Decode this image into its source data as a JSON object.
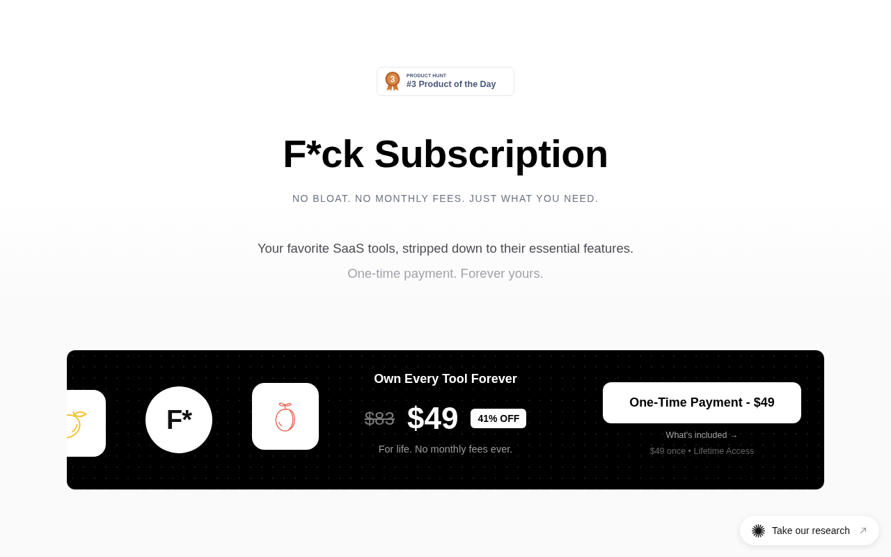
{
  "badge": {
    "rank": "3",
    "eyebrow": "PRODUCT HUNT",
    "title": "#3 Product of the Day"
  },
  "hero": {
    "title": "F*ck Subscription",
    "tagline": "NO BLOAT. NO MONTHLY FEES. JUST WHAT YOU NEED.",
    "description": "Your favorite SaaS tools, stripped down to their essential features.",
    "subdescription": "One-time payment. Forever yours."
  },
  "offer": {
    "apps": [
      {
        "kind": "lemon",
        "color": "#f2c12e"
      },
      {
        "kind": "logo",
        "text": "F*"
      },
      {
        "kind": "peach",
        "color": "#ec6a58"
      }
    ],
    "heading": "Own Every Tool Forever",
    "old_price": "$83",
    "price": "$49",
    "discount": "41% OFF",
    "note": "For life. No monthly fees ever.",
    "button": "One-Time Payment - $49",
    "included_link": "What's included →",
    "summary": "$49 once • Lifetime Access"
  },
  "research_button": {
    "label": "Take our research"
  }
}
